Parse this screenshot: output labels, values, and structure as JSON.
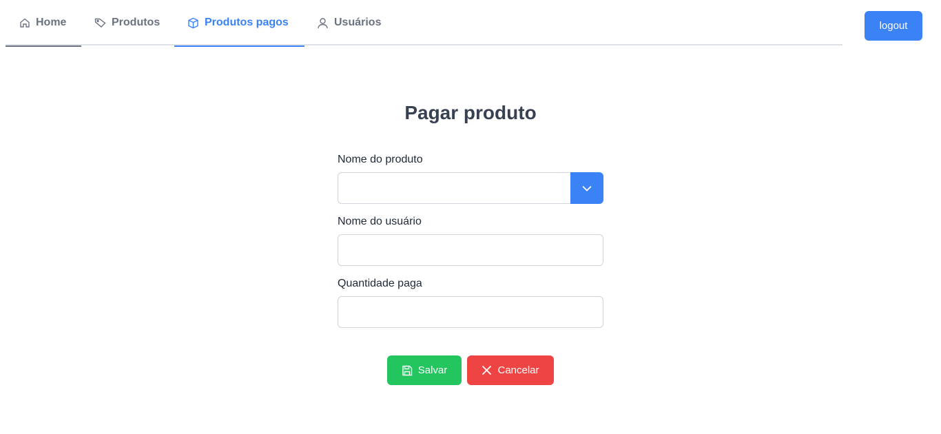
{
  "nav": {
    "tabs": [
      {
        "label": "Home",
        "icon": "home-icon"
      },
      {
        "label": "Produtos",
        "icon": "tag-icon"
      },
      {
        "label": "Produtos pagos",
        "icon": "box-icon",
        "active": true
      },
      {
        "label": "Usuários",
        "icon": "user-icon"
      }
    ],
    "logout_label": "logout"
  },
  "form": {
    "title": "Pagar produto",
    "product_label": "Nome do produto",
    "product_value": "",
    "user_label": "Nome do usuário",
    "user_value": "",
    "quantity_label": "Quantidade paga",
    "quantity_value": ""
  },
  "actions": {
    "save_label": "Salvar",
    "cancel_label": "Cancelar"
  },
  "colors": {
    "primary": "#3b82f6",
    "success": "#22c55e",
    "danger": "#ef4444"
  }
}
